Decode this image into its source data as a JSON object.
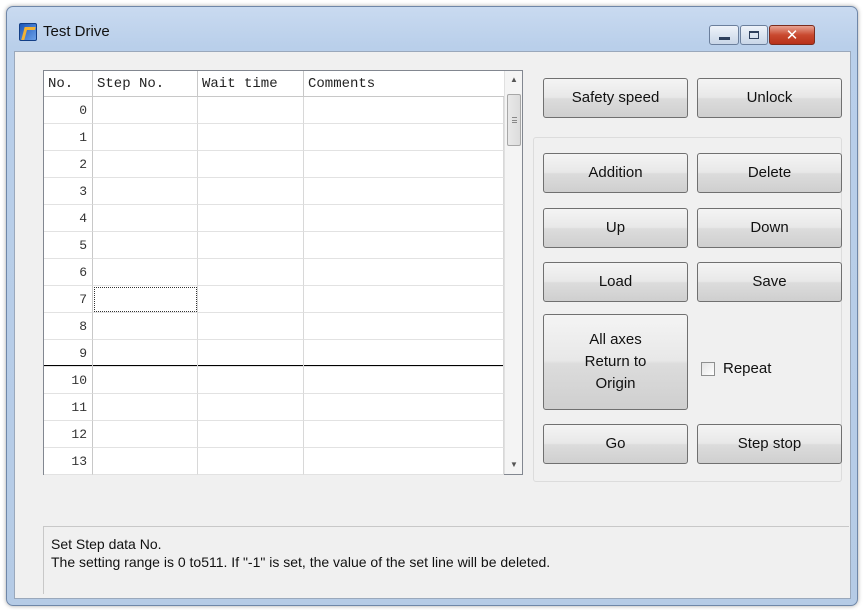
{
  "window": {
    "title": "Test Drive"
  },
  "grid": {
    "columns": [
      "No.",
      "Step No.",
      "Wait time",
      "Comments"
    ],
    "rows": [
      {
        "no": "0",
        "step": "",
        "wait": "",
        "comment": ""
      },
      {
        "no": "1",
        "step": "",
        "wait": "",
        "comment": ""
      },
      {
        "no": "2",
        "step": "",
        "wait": "",
        "comment": ""
      },
      {
        "no": "3",
        "step": "",
        "wait": "",
        "comment": ""
      },
      {
        "no": "4",
        "step": "",
        "wait": "",
        "comment": ""
      },
      {
        "no": "5",
        "step": "",
        "wait": "",
        "comment": ""
      },
      {
        "no": "6",
        "step": "",
        "wait": "",
        "comment": ""
      },
      {
        "no": "7",
        "step": "",
        "wait": "",
        "comment": ""
      },
      {
        "no": "8",
        "step": "",
        "wait": "",
        "comment": ""
      },
      {
        "no": "9",
        "step": "",
        "wait": "",
        "comment": ""
      },
      {
        "no": "10",
        "step": "",
        "wait": "",
        "comment": ""
      },
      {
        "no": "11",
        "step": "",
        "wait": "",
        "comment": ""
      },
      {
        "no": "12",
        "step": "",
        "wait": "",
        "comment": ""
      },
      {
        "no": "13",
        "step": "",
        "wait": "",
        "comment": ""
      }
    ]
  },
  "buttons": {
    "safety_speed": "Safety speed",
    "unlock": "Unlock",
    "addition": "Addition",
    "delete": "Delete",
    "up": "Up",
    "down": "Down",
    "load": "Load",
    "save": "Save",
    "all_axes_line1": "All axes",
    "all_axes_line2": "Return to",
    "all_axes_line3": "Origin",
    "go": "Go",
    "step_stop": "Step stop"
  },
  "repeat": {
    "label": "Repeat",
    "checked": false
  },
  "status": {
    "line1": "Set Step data No.",
    "line2": "The setting range is 0 to511.  If \"-1\" is set, the value of the set line will be deleted."
  }
}
